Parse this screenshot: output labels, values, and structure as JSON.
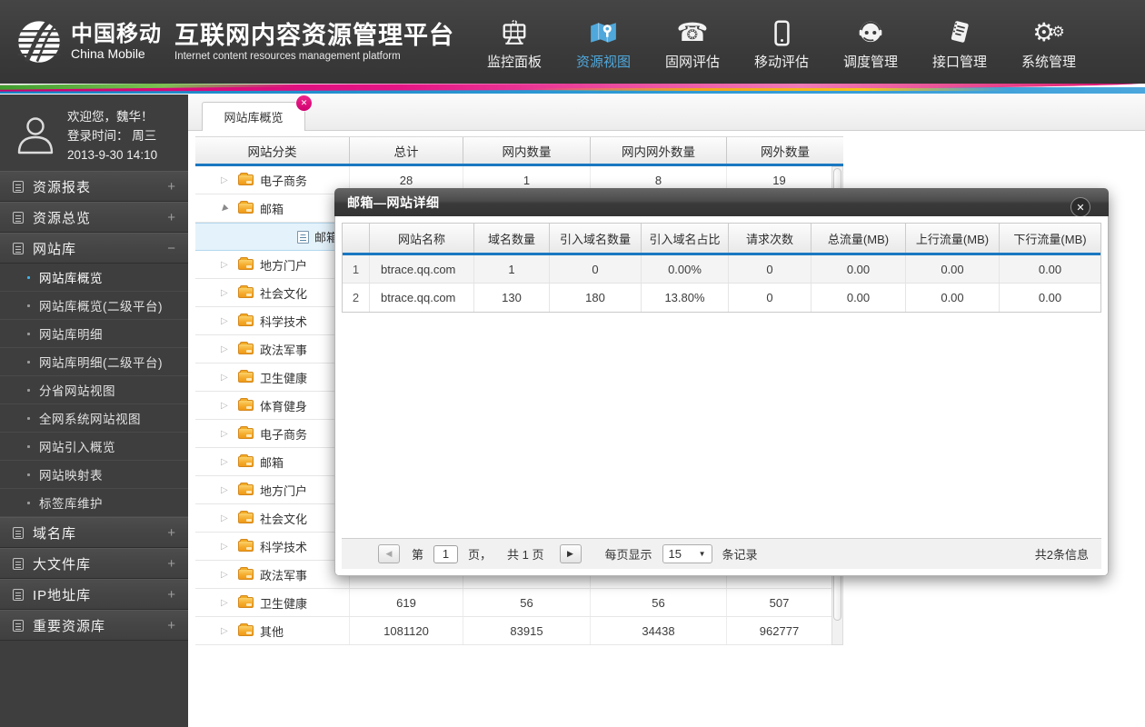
{
  "header": {
    "logo_cn": "中国移动",
    "logo_en": "China Mobile",
    "title": "互联网内容资源管理平台",
    "subtitle": "Internet content resources management platform",
    "accent_color": "#4fa8dc",
    "nav": [
      {
        "label": "监控面板",
        "icon": "dashboard-icon",
        "active": false
      },
      {
        "label": "资源视图",
        "icon": "map-icon",
        "active": true
      },
      {
        "label": "固网评估",
        "icon": "telephone-icon",
        "active": false
      },
      {
        "label": "移动评估",
        "icon": "mobile-icon",
        "active": false
      },
      {
        "label": "调度管理",
        "icon": "headset-icon",
        "active": false
      },
      {
        "label": "接口管理",
        "icon": "document-icon",
        "active": false
      },
      {
        "label": "系统管理",
        "icon": "gears-icon",
        "active": false
      }
    ]
  },
  "sidebar": {
    "user": {
      "welcome": "欢迎您，魏华！",
      "login_line1": "登录时间：  周三",
      "login_line2": "2013-9-30   14:10"
    },
    "groups": [
      {
        "label": "资源报表",
        "state": "+"
      },
      {
        "label": "资源总览",
        "state": "+"
      },
      {
        "label": "网站库",
        "state": "−"
      },
      {
        "label": "域名库",
        "state": "+"
      },
      {
        "label": "大文件库",
        "state": "+"
      },
      {
        "label": "IP地址库",
        "state": "+"
      },
      {
        "label": "重要资源库",
        "state": "+"
      }
    ],
    "website_items": [
      {
        "label": "网站库概览",
        "active": true
      },
      {
        "label": "网站库概览(二级平台)",
        "active": false
      },
      {
        "label": "网站库明细",
        "active": false
      },
      {
        "label": "网站库明细(二级平台)",
        "active": false
      },
      {
        "label": "分省网站视图",
        "active": false
      },
      {
        "label": "全网系统网站视图",
        "active": false
      },
      {
        "label": "网站引入概览",
        "active": false
      },
      {
        "label": "网站映射表",
        "active": false
      },
      {
        "label": "标签库维护",
        "active": false
      }
    ]
  },
  "tab": {
    "label": "网站库概览",
    "close_glyph": "✕"
  },
  "main_table": {
    "columns": [
      "网站分类",
      "总计",
      "网内数量",
      "网内网外数量",
      "网外数量"
    ],
    "rows": [
      {
        "state": "collapsed",
        "label": "电子商务",
        "values": [
          "28",
          "1",
          "8",
          "19"
        ]
      },
      {
        "state": "expanded",
        "label": "邮箱",
        "values": [
          "",
          "",
          "",
          ""
        ]
      },
      {
        "state": "child-selected",
        "label": "邮箱",
        "values": [
          "",
          "",
          "",
          ""
        ]
      },
      {
        "state": "collapsed",
        "label": "地方门户",
        "values": [
          "",
          "",
          "",
          ""
        ]
      },
      {
        "state": "collapsed",
        "label": "社会文化",
        "values": [
          "",
          "",
          "",
          ""
        ]
      },
      {
        "state": "collapsed",
        "label": "科学技术",
        "values": [
          "",
          "",
          "",
          ""
        ]
      },
      {
        "state": "collapsed",
        "label": "政法军事",
        "values": [
          "",
          "",
          "",
          ""
        ]
      },
      {
        "state": "collapsed",
        "label": "卫生健康",
        "values": [
          "",
          "",
          "",
          ""
        ]
      },
      {
        "state": "collapsed",
        "label": "体育健身",
        "values": [
          "",
          "",
          "",
          ""
        ]
      },
      {
        "state": "collapsed",
        "label": "电子商务",
        "values": [
          "",
          "",
          "",
          ""
        ]
      },
      {
        "state": "collapsed",
        "label": "邮箱",
        "values": [
          "",
          "",
          "",
          ""
        ]
      },
      {
        "state": "collapsed",
        "label": "地方门户",
        "values": [
          "",
          "",
          "",
          ""
        ]
      },
      {
        "state": "collapsed",
        "label": "社会文化",
        "values": [
          "",
          "",
          "",
          ""
        ]
      },
      {
        "state": "collapsed",
        "label": "科学技术",
        "values": [
          "",
          "",
          "",
          ""
        ]
      },
      {
        "state": "collapsed",
        "label": "政法军事",
        "values": [
          "",
          "",
          "",
          ""
        ]
      },
      {
        "state": "collapsed",
        "label": "卫生健康",
        "values": [
          "619",
          "56",
          "56",
          "507"
        ]
      },
      {
        "state": "collapsed",
        "label": "其他",
        "values": [
          "1081120",
          "83915",
          "34438",
          "962777"
        ]
      }
    ]
  },
  "modal": {
    "title": "邮箱—网站详细",
    "close_glyph": "✕",
    "columns": [
      "",
      "网站名称",
      "域名数量",
      "引入域名数量",
      "引入域名占比",
      "请求次数",
      "总流量(MB)",
      "上行流量(MB)",
      "下行流量(MB)"
    ],
    "rows": [
      [
        "1",
        "btrace.qq.com",
        "1",
        "0",
        "0.00%",
        "0",
        "0.00",
        "0.00",
        "0.00"
      ],
      [
        "2",
        "btrace.qq.com",
        "130",
        "180",
        "13.80%",
        "0",
        "0.00",
        "0.00",
        "0.00"
      ]
    ],
    "pagination": {
      "prev_glyph": "◀",
      "next_glyph": "▶",
      "page_prefix": "第",
      "page_value": "1",
      "page_suffix": "页，",
      "total_pages": "共 1 页",
      "per_page_label": "每页显示",
      "per_page_value": "15",
      "caret_glyph": "▼",
      "per_page_suffix": "条记录",
      "total_info": "共2条信息"
    }
  }
}
